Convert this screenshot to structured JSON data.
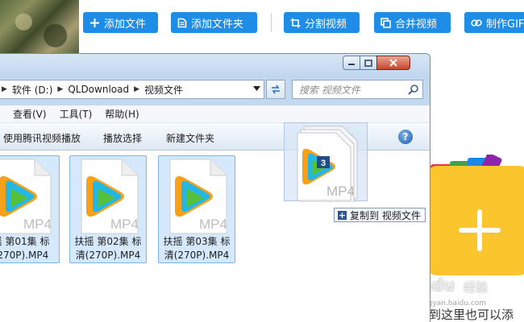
{
  "toolbar": {
    "buttons": [
      {
        "label": "添加文件",
        "icon": "plus-icon"
      },
      {
        "label": "添加文件夹",
        "icon": "file-icon"
      },
      {
        "label": "分割视频",
        "icon": "crop-icon"
      },
      {
        "label": "合并视频",
        "icon": "copy-icon"
      },
      {
        "label": "制作GIF",
        "icon": "link-icon"
      }
    ],
    "accent_color": "#1e8de8"
  },
  "explorer": {
    "breadcrumb": [
      "软件 (D:)",
      "QLDownload",
      "视频文件"
    ],
    "search_placeholder": "搜索 视频文件",
    "menu": [
      "查看(V)",
      "工具(T)",
      "帮助(H)"
    ],
    "commands": [
      "使用腾讯视频播放",
      "播放选择",
      "新建文件夹"
    ],
    "help_label": "?",
    "files": [
      {
        "line1": "摇 第01集 标",
        "line2": "(270P).MP4",
        "ext": "MP4"
      },
      {
        "line1": "扶摇 第02集 标",
        "line2": "清(270P).MP4",
        "ext": "MP4"
      },
      {
        "line1": "扶摇 第03集 标",
        "line2": "清(270P).MP4",
        "ext": "MP4"
      }
    ]
  },
  "drag": {
    "count_badge": "3",
    "ext": "MP4",
    "tooltip": "复制到 视频文件"
  },
  "right_panel": {
    "bottom_text": "到这里也可以添",
    "watermark": "Baidu",
    "watermark_cn": "经验",
    "watermark_url": "jingyan.baidu.com"
  }
}
